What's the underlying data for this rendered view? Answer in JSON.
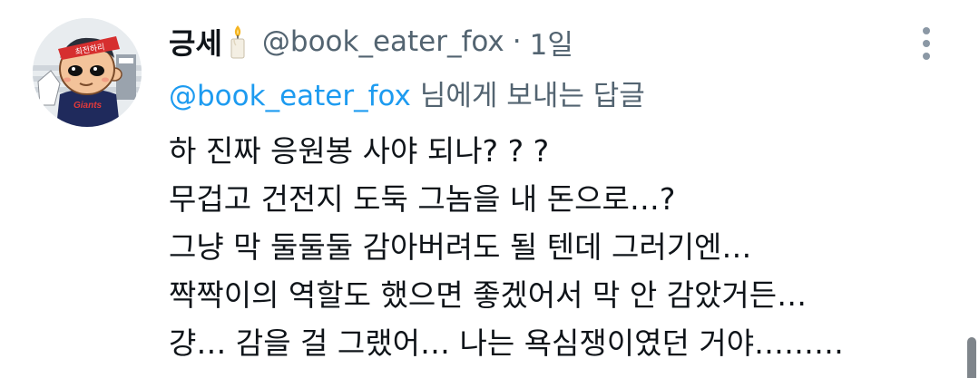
{
  "tweet": {
    "display_name": "긍세",
    "name_emoji": "candle-icon",
    "handle": "@book_eater_fox",
    "separator": "·",
    "time": "1일",
    "reply": {
      "mention": "@book_eater_fox",
      "suffix": "님에게 보내는 답글"
    },
    "lines": [
      "하 진짜 응원봉 사야 되나? ? ?",
      "무겁고 건전지 도둑 그놈을 내 돈으로…?",
      "그냥 막 둘둘둘 감아버려도 될 텐데 그러기엔…",
      "짝짝이의 역할도 했으면 좋겠어서 막 안 감았거든…",
      "걍… 감을 걸 그랬어… 나는 욕심쟁이였던 거야………"
    ],
    "avatar_text": "Giants",
    "avatar_headband_text": "최전하리"
  },
  "icons": {
    "more": "vertical-ellipsis-icon",
    "avatar": "cartoon-avatar"
  },
  "colors": {
    "text": "#0f1419",
    "secondary": "#536471",
    "link": "#1d9bf0",
    "headband_red": "#d62f2f",
    "jersey_navy": "#1f2a5c"
  }
}
